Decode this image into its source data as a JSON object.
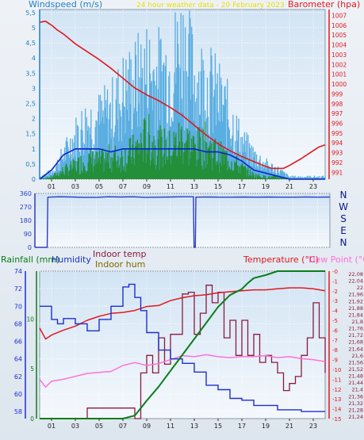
{
  "colors": {
    "wind": "#1f7fc4",
    "wind_fill": "#4aa6de",
    "wind_avg": "#0b22c8",
    "wind_green": "#1a8a1a",
    "barometer": "#e0181e",
    "direction": "#2a3cc8",
    "rainfall": "#0a7d1a",
    "humidity": "#1e2ed0",
    "indoor_temp": "#8b1a40",
    "indoor_hum": "#7a6a00",
    "temperature": "#e0181e",
    "dew_point": "#ff70d8",
    "title_yellow": "#e8e000"
  },
  "chart_data": [
    {
      "type": "line",
      "title": "24 hour weather data - 20 February 2023",
      "ylabel_left": "Windspeed (m/s)",
      "ylabel_right": "Barometer (hpa)",
      "x_ticks": [
        "01",
        "03",
        "05",
        "07",
        "09",
        "11",
        "13",
        "15",
        "17",
        "19",
        "21",
        "23"
      ],
      "y_ticks_left": [
        "0",
        "0,5",
        "1",
        "1,5",
        "2",
        "2,5",
        "3",
        "3,5",
        "4",
        "4,5",
        "5",
        "5,5"
      ],
      "y_ticks_right": [
        "991",
        "992",
        "993",
        "994",
        "995",
        "996",
        "997",
        "998",
        "999",
        "1000",
        "1001",
        "1002",
        "1003",
        "1004",
        "1005",
        "1006",
        "1007"
      ],
      "ylim_left": [
        0,
        5.6
      ],
      "ylim_right": [
        990.3,
        1007.6
      ],
      "xlim": [
        0,
        24
      ],
      "series": [
        {
          "name": "Barometer",
          "axis": "right",
          "x": [
            0,
            0.5,
            1,
            1.5,
            2,
            3,
            4,
            5,
            6,
            7,
            8,
            9,
            10,
            11,
            12,
            13,
            14,
            15,
            16,
            17,
            18,
            19,
            19.5,
            20,
            20.5,
            21,
            22,
            23,
            23.5,
            24
          ],
          "y": [
            1006.3,
            1006.4,
            1006.0,
            1005.5,
            1005.1,
            1004.1,
            1003.3,
            1002.5,
            1001.6,
            1000.6,
            999.6,
            998.9,
            998.3,
            997.6,
            996.8,
            995.8,
            994.8,
            993.9,
            993.2,
            992.6,
            992.1,
            991.6,
            991.4,
            991.4,
            991.4,
            991.7,
            992.4,
            993.2,
            993.6,
            993.8
          ]
        },
        {
          "name": "Wind gust",
          "axis": "left",
          "x": [
            0,
            1,
            2,
            3,
            4,
            5,
            6,
            7,
            8,
            9,
            10,
            11,
            12,
            13,
            14,
            15,
            16,
            17,
            18,
            19,
            20,
            21,
            22,
            23,
            24
          ],
          "y": [
            0.1,
            0.3,
            1.0,
            1.8,
            2.4,
            2.5,
            2.8,
            3.6,
            4.0,
            4.5,
            4.3,
            4.6,
            5.6,
            4.2,
            4.0,
            3.4,
            2.6,
            1.5,
            1.0,
            0.6,
            0.4,
            0.1,
            0.1,
            0.1,
            0.1
          ]
        },
        {
          "name": "Wind speed",
          "axis": "left",
          "x": [
            0,
            1,
            2,
            3,
            4,
            5,
            6,
            7,
            8,
            9,
            10,
            11,
            12,
            13,
            14,
            15,
            16,
            17,
            18,
            19,
            20,
            21,
            22,
            23,
            24
          ],
          "y": [
            0.0,
            0.1,
            0.4,
            0.6,
            0.9,
            0.8,
            1.0,
            1.0,
            1.3,
            1.9,
            1.5,
            1.4,
            1.9,
            1.4,
            1.6,
            1.1,
            0.9,
            0.5,
            0.2,
            0.1,
            0.1,
            0.0,
            0.0,
            0.0,
            0.0
          ]
        },
        {
          "name": "Wind average",
          "axis": "left",
          "x": [
            0,
            1,
            2,
            3,
            4,
            5,
            6,
            7,
            8,
            9,
            10,
            11,
            12,
            13,
            14,
            15,
            16,
            17,
            18,
            19,
            20,
            21,
            22,
            23,
            24
          ],
          "y": [
            0.0,
            0.3,
            0.8,
            1.0,
            1.0,
            1.0,
            0.9,
            1.0,
            1.0,
            1.0,
            1.0,
            1.0,
            1.0,
            1.0,
            0.9,
            0.9,
            0.8,
            0.6,
            0.3,
            0.2,
            0.1,
            0.0,
            0.0,
            0.0,
            0.0
          ]
        }
      ]
    },
    {
      "type": "line",
      "ylabel_right": [
        "N",
        "W",
        "S",
        "E",
        "N"
      ],
      "x_ticks": [
        "01",
        "03",
        "05",
        "07",
        "09",
        "11",
        "13",
        "15",
        "17",
        "19",
        "21",
        "23"
      ],
      "y_ticks_left": [
        "0",
        "90",
        "180",
        "270",
        "360"
      ],
      "ylim": [
        0,
        360
      ],
      "xlim": [
        0,
        24
      ],
      "series": [
        {
          "name": "Wind direction",
          "x": [
            0,
            1,
            1.05,
            2,
            3,
            4,
            5,
            6,
            7,
            8,
            9,
            10,
            11,
            12,
            12.9,
            12.95,
            13.05,
            13.1,
            14,
            15,
            16,
            17,
            18,
            19,
            20,
            21,
            22,
            23,
            24
          ],
          "y": [
            0,
            0,
            335,
            338,
            336,
            334,
            334,
            338,
            336,
            338,
            334,
            335,
            336,
            338,
            338,
            0,
            0,
            335,
            336,
            335,
            335,
            336,
            335,
            336,
            335,
            335,
            336,
            335,
            336
          ]
        }
      ]
    },
    {
      "type": "line",
      "ylabel_left": "Rainfall (mm)",
      "ylabel_left2": "Humidity",
      "legend_middle": [
        "Indoor temp",
        "Indoor hum"
      ],
      "ylabel_right": "Temperature (°C)",
      "ylabel_right2": "Dew Point (°C)",
      "x_ticks": [
        "01",
        "03",
        "05",
        "07",
        "09",
        "11",
        "13",
        "15",
        "17",
        "19",
        "21",
        "23"
      ],
      "y_ticks_rain": [
        "0",
        "5",
        "10"
      ],
      "y_ticks_humidity": [
        "58",
        "60",
        "62",
        "64",
        "66",
        "68",
        "70",
        "72",
        "74"
      ],
      "y_ticks_temperature": [
        "-0",
        "-1",
        "-2",
        "-3",
        "-4",
        "-5",
        "-6",
        "-7",
        "-8",
        "-9",
        "-10",
        "-11",
        "-12",
        "-13",
        "-14",
        "-15"
      ],
      "y_ticks_indoor": [
        "22,08",
        "22,04",
        "22",
        "21,96",
        "21,92",
        "21,88",
        "21,84",
        "21,8",
        "21,76",
        "21,72",
        "21,68",
        "21,64",
        "21,6",
        "21,56",
        "21,52",
        "21,48",
        "21,44",
        "21,4",
        "21,36",
        "21,32",
        "21,28",
        "21,24"
      ],
      "ylim_rain": [
        0,
        14.8
      ],
      "ylim_humidity": [
        57.2,
        74
      ],
      "ylim_temperature": [
        -15,
        0
      ],
      "xlim": [
        0,
        24
      ],
      "series": [
        {
          "name": "Rainfall",
          "axis": "rain",
          "x": [
            0,
            7,
            8,
            9,
            10,
            11,
            12,
            13,
            14,
            15,
            16,
            17,
            17.5,
            18,
            19,
            19.5,
            20,
            21,
            22,
            23,
            23.5,
            24
          ],
          "y": [
            0,
            0,
            0.3,
            1.8,
            3.2,
            4.8,
            6.4,
            8.0,
            9.6,
            11.2,
            12.4,
            13.0,
            13.6,
            14.1,
            14.4,
            14.6,
            14.8,
            14.8,
            14.8,
            14.8,
            14.8,
            14.8
          ]
        },
        {
          "name": "Humidity",
          "axis": "humidity",
          "x": [
            0,
            0.5,
            1,
            1.5,
            2,
            3,
            4,
            5,
            6,
            7,
            7.5,
            8,
            8.5,
            9,
            10,
            11,
            12,
            13,
            14,
            15,
            16,
            17,
            18,
            19,
            20,
            21,
            22,
            23,
            24
          ],
          "y": [
            70,
            70,
            68.5,
            68,
            68.6,
            68,
            67.2,
            68.5,
            70,
            72.2,
            72.5,
            71,
            69.5,
            67,
            65,
            64,
            63.5,
            62.5,
            61,
            60.5,
            59.5,
            59.3,
            58.7,
            58.7,
            58.2,
            58.2,
            58.0,
            58.0,
            58.0
          ]
        },
        {
          "name": "Indoor temp",
          "axis": "indoor",
          "x": [
            0,
            1,
            2,
            3,
            4,
            5,
            6,
            7,
            7.5,
            8,
            8.5,
            9,
            9.5,
            10,
            10.5,
            11,
            12,
            12.5,
            13,
            13.5,
            14,
            14.5,
            15,
            15.5,
            16,
            16.5,
            17,
            17.5,
            18,
            18.5,
            19,
            19.5,
            20,
            20.5,
            21,
            21.5,
            22,
            22.5,
            23,
            23.5,
            24
          ],
          "y": [
            21.24,
            21.24,
            21.24,
            21.24,
            21.3,
            21.3,
            21.3,
            21.3,
            21.3,
            21.24,
            21.5,
            21.6,
            21.5,
            21.7,
            21.55,
            21.72,
            21.95,
            21.96,
            21.72,
            21.84,
            22.0,
            21.9,
            21.96,
            21.7,
            21.8,
            21.6,
            21.8,
            21.6,
            21.72,
            21.56,
            21.6,
            21.56,
            21.5,
            21.4,
            21.44,
            21.48,
            21.6,
            21.7,
            21.9,
            21.7,
            21.5
          ]
        },
        {
          "name": "Temperature",
          "axis": "temperature",
          "x": [
            0,
            0.5,
            1,
            2,
            3,
            4,
            5,
            6,
            7,
            8,
            9,
            10,
            11,
            12,
            13,
            14,
            15,
            16,
            17,
            18,
            19,
            20,
            21,
            22,
            23,
            24
          ],
          "y": [
            -5.8,
            -6.9,
            -6.5,
            -6.0,
            -5.6,
            -5.0,
            -4.6,
            -4.3,
            -4.2,
            -4.0,
            -3.6,
            -3.5,
            -3.0,
            -2.7,
            -2.5,
            -2.4,
            -2.2,
            -2.1,
            -2.0,
            -1.9,
            -1.9,
            -1.8,
            -1.7,
            -1.7,
            -1.8,
            -2.0
          ]
        },
        {
          "name": "Dew Point",
          "axis": "temperature",
          "x": [
            0,
            0.5,
            1,
            2,
            3,
            4,
            5,
            6,
            7,
            8,
            9,
            10,
            11,
            12,
            13,
            14,
            15,
            16,
            17,
            18,
            19,
            20,
            21,
            22,
            23,
            24
          ],
          "y": [
            -11.0,
            -11.8,
            -11.2,
            -11.0,
            -10.7,
            -10.4,
            -10.3,
            -10.2,
            -9.6,
            -9.3,
            -9.6,
            -9.4,
            -9.0,
            -8.6,
            -8.7,
            -8.5,
            -8.7,
            -8.8,
            -8.7,
            -8.7,
            -8.6,
            -8.8,
            -8.7,
            -8.9,
            -9.0,
            -9.2
          ]
        }
      ]
    }
  ]
}
